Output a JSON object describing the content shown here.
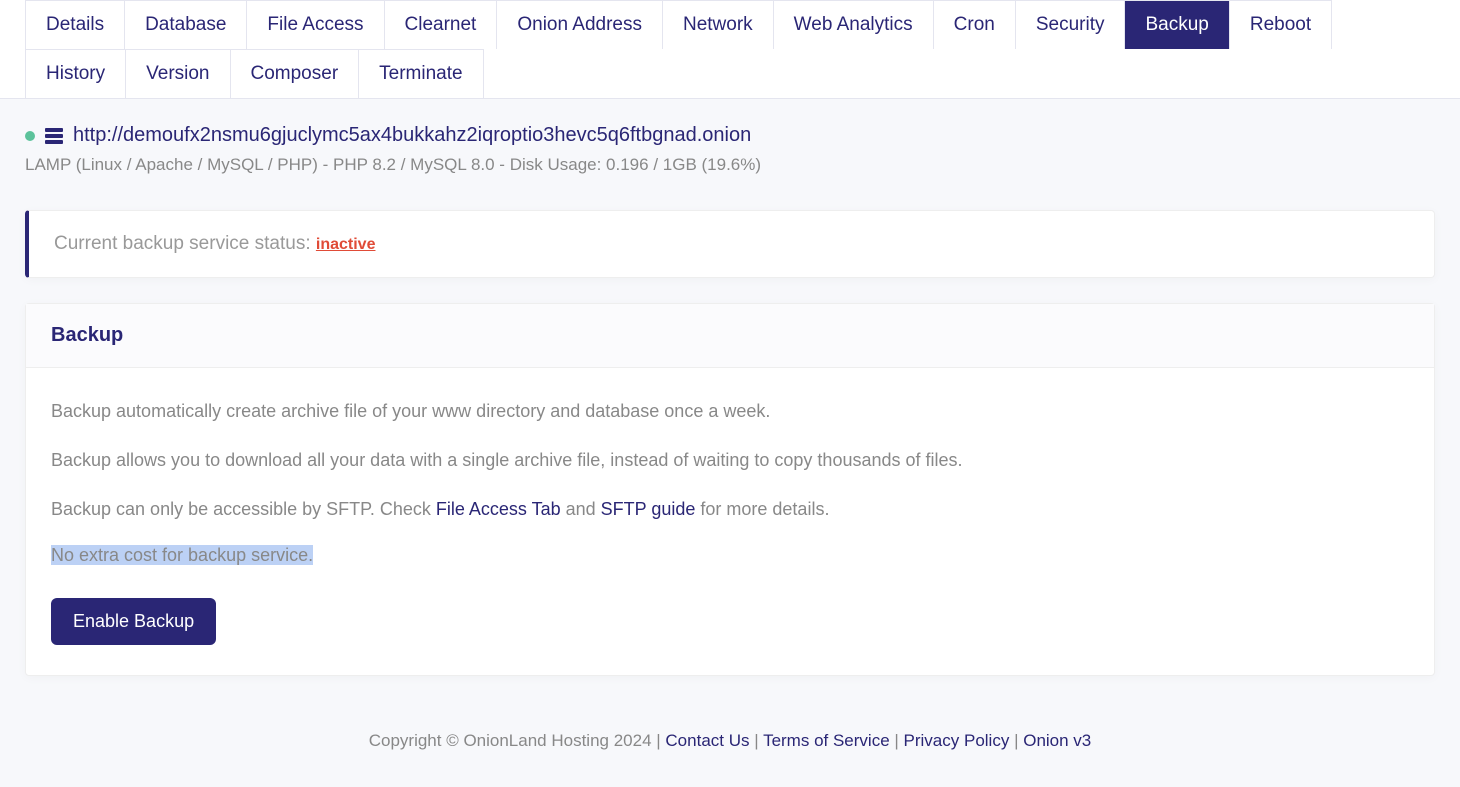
{
  "tabs": {
    "row1": [
      {
        "label": "Details",
        "active": false
      },
      {
        "label": "Database",
        "active": false
      },
      {
        "label": "File Access",
        "active": false
      },
      {
        "label": "Clearnet",
        "active": false
      },
      {
        "label": "Onion Address",
        "active": false
      },
      {
        "label": "Network",
        "active": false
      },
      {
        "label": "Web Analytics",
        "active": false
      },
      {
        "label": "Cron",
        "active": false
      },
      {
        "label": "Security",
        "active": false
      },
      {
        "label": "Backup",
        "active": true
      },
      {
        "label": "Reboot",
        "active": false
      }
    ],
    "row2": [
      {
        "label": "History",
        "active": false
      },
      {
        "label": "Version",
        "active": false
      },
      {
        "label": "Composer",
        "active": false
      },
      {
        "label": "Terminate",
        "active": false
      }
    ]
  },
  "info": {
    "onion_url": "http://demoufx2nsmu6gjuclymc5ax4bukkahz2iqroptio3hevc5q6ftbgnad.onion",
    "stack": "LAMP (Linux / Apache / MySQL / PHP) - PHP 8.2 / MySQL 8.0 - Disk Usage: 0.196 / 1GB (19.6%)"
  },
  "status": {
    "label": "Current backup service status: ",
    "value": "inactive"
  },
  "card": {
    "title": "Backup",
    "p1": "Backup automatically create archive file of your www directory and database once a week.",
    "p2": "Backup allows you to download all your data with a single archive file, instead of waiting to copy thousands of files.",
    "p3_pre": "Backup can only be accessible by SFTP. Check ",
    "p3_link1": "File Access Tab",
    "p3_mid": " and ",
    "p3_link2": "SFTP guide",
    "p3_post": " for more details.",
    "highlight": "No extra cost for backup service.",
    "button": "Enable Backup"
  },
  "footer": {
    "copyright": "Copyright © OnionLand Hosting 2024 ",
    "sep": " | ",
    "links": {
      "contact": "Contact Us",
      "tos": "Terms of Service",
      "privacy": "Privacy Policy",
      "onionv3": "Onion v3"
    }
  }
}
